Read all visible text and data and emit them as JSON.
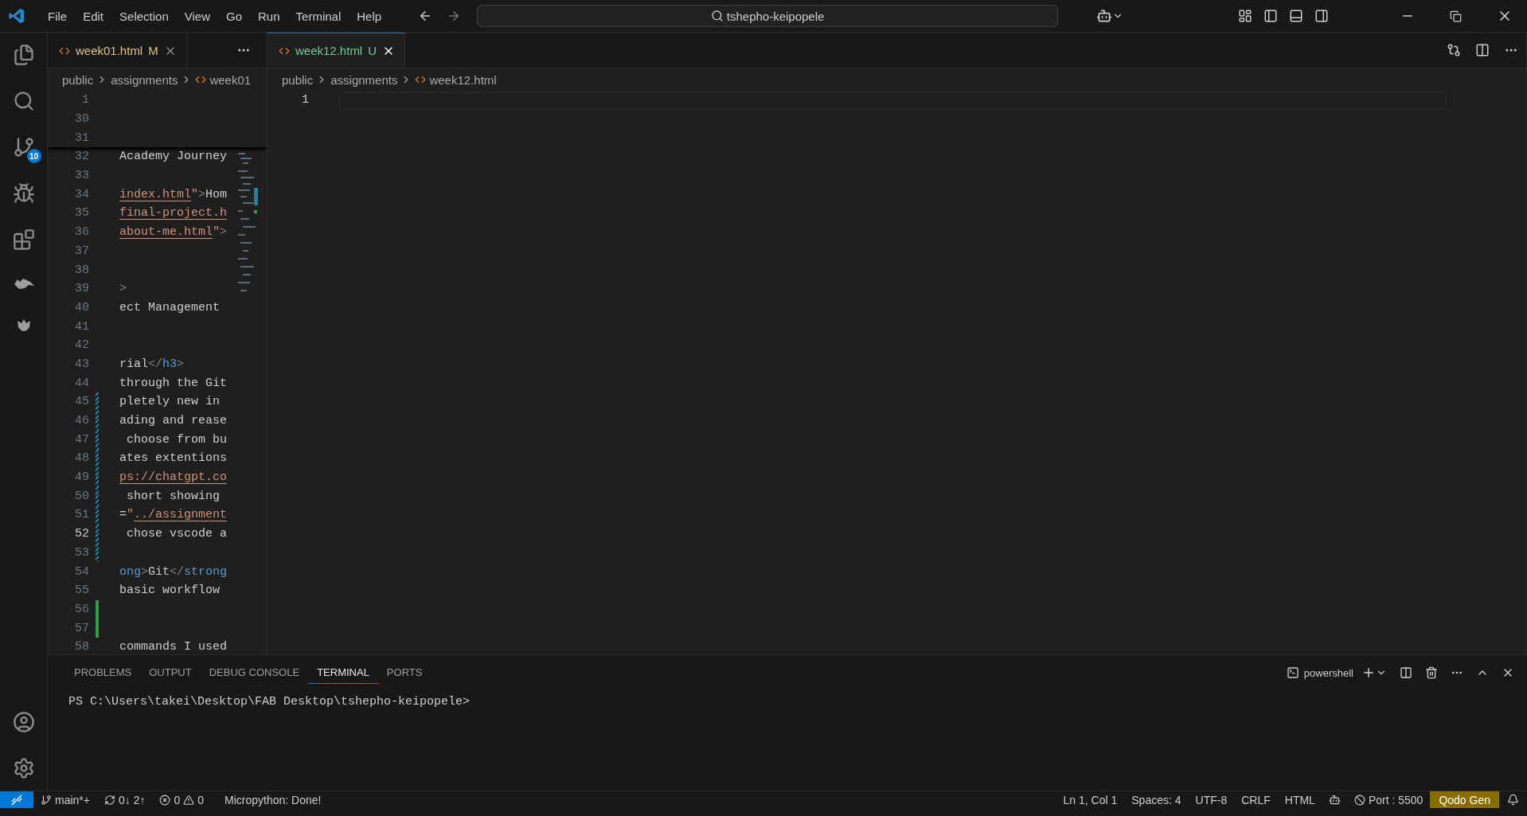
{
  "menu": [
    "File",
    "Edit",
    "Selection",
    "View",
    "Go",
    "Run",
    "Terminal",
    "Help"
  ],
  "command_center": {
    "value": "tshepho-keipopele"
  },
  "activity_bar": {
    "source_control_badge": "10"
  },
  "editor_groups": [
    {
      "tab": {
        "label": "week01.html",
        "status": "M",
        "selected": false
      },
      "breadcrumb": [
        "public",
        "assignments",
        "week01"
      ],
      "sticky_lines": [
        {
          "number": "1"
        },
        {
          "number": "30"
        },
        {
          "number": "31"
        }
      ],
      "lines": [
        {
          "number": "32",
          "current": false,
          "modified": false,
          "added": false,
          "segments": [
            {
              "kind": "text",
              "text": "Academy Journey"
            }
          ]
        },
        {
          "number": "33",
          "current": false,
          "modified": false,
          "added": false
        },
        {
          "number": "34",
          "current": false,
          "modified": false,
          "added": false,
          "segments": [
            {
              "kind": "link",
              "text": "index.html"
            },
            {
              "kind": "string",
              "text": "\""
            },
            {
              "kind": "punct",
              "text": ">"
            },
            {
              "kind": "text",
              "text": "Hom"
            }
          ]
        },
        {
          "number": "35",
          "current": false,
          "modified": false,
          "added": false,
          "segments": [
            {
              "kind": "link",
              "text": "final-project.h"
            }
          ]
        },
        {
          "number": "36",
          "current": false,
          "modified": false,
          "added": false,
          "segments": [
            {
              "kind": "link",
              "text": "about-me.html"
            },
            {
              "kind": "string",
              "text": "\""
            },
            {
              "kind": "punct",
              "text": ">"
            }
          ]
        },
        {
          "number": "37",
          "current": false,
          "modified": false,
          "added": false
        },
        {
          "number": "38",
          "current": false,
          "modified": false,
          "added": false
        },
        {
          "number": "39",
          "current": false,
          "modified": false,
          "added": false,
          "segments": [
            {
              "kind": "punct",
              "text": ">"
            }
          ]
        },
        {
          "number": "40",
          "current": false,
          "modified": false,
          "added": false,
          "segments": [
            {
              "kind": "text",
              "text": "ect Management"
            }
          ]
        },
        {
          "number": "41",
          "current": false,
          "modified": false,
          "added": false
        },
        {
          "number": "42",
          "current": false,
          "modified": false,
          "added": false
        },
        {
          "number": "43",
          "current": false,
          "modified": false,
          "added": false,
          "segments": [
            {
              "kind": "text",
              "text": "rial"
            },
            {
              "kind": "punct",
              "text": "</"
            },
            {
              "kind": "tag",
              "text": "h3"
            },
            {
              "kind": "punct",
              "text": ">"
            }
          ]
        },
        {
          "number": "44",
          "current": false,
          "modified": false,
          "added": false,
          "segments": [
            {
              "kind": "text",
              "text": "through the Git"
            }
          ]
        },
        {
          "number": "45",
          "current": false,
          "modified": true,
          "added": false,
          "segments": [
            {
              "kind": "text",
              "text": "pletely new in"
            }
          ]
        },
        {
          "number": "46",
          "current": false,
          "modified": true,
          "added": false,
          "segments": [
            {
              "kind": "text",
              "text": "ading and rease"
            }
          ]
        },
        {
          "number": "47",
          "current": false,
          "modified": true,
          "added": false,
          "segments": [
            {
              "kind": "text",
              "text": " choose from bu"
            }
          ]
        },
        {
          "number": "48",
          "current": false,
          "modified": true,
          "added": false,
          "segments": [
            {
              "kind": "text",
              "text": "ates extentions"
            }
          ]
        },
        {
          "number": "49",
          "current": false,
          "modified": true,
          "added": false,
          "segments": [
            {
              "kind": "link",
              "text": "ps://chatgpt.co"
            }
          ]
        },
        {
          "number": "50",
          "current": false,
          "modified": true,
          "added": false,
          "segments": [
            {
              "kind": "text",
              "text": " short showing"
            }
          ]
        },
        {
          "number": "51",
          "current": false,
          "modified": true,
          "added": false,
          "segments": [
            {
              "kind": "text",
              "text": "="
            },
            {
              "kind": "string",
              "text": "\""
            },
            {
              "kind": "link",
              "text": "../assignment"
            }
          ]
        },
        {
          "number": "52",
          "current": true,
          "modified": true,
          "added": false,
          "segments": [
            {
              "kind": "text",
              "text": " chose vscode a"
            }
          ]
        },
        {
          "number": "53",
          "current": false,
          "modified": true,
          "added": false
        },
        {
          "number": "54",
          "current": false,
          "modified": false,
          "added": false,
          "segments": [
            {
              "kind": "tag",
              "text": "ong"
            },
            {
              "kind": "punct",
              "text": ">"
            },
            {
              "kind": "text",
              "text": "Git"
            },
            {
              "kind": "punct",
              "text": "</"
            },
            {
              "kind": "tag",
              "text": "strong"
            }
          ]
        },
        {
          "number": "55",
          "current": false,
          "modified": false,
          "added": false,
          "segments": [
            {
              "kind": "text",
              "text": "basic workflow"
            }
          ]
        },
        {
          "number": "56",
          "current": false,
          "modified": false,
          "added": true
        },
        {
          "number": "57",
          "current": false,
          "modified": false,
          "added": true
        },
        {
          "number": "58",
          "current": false,
          "modified": false,
          "added": false,
          "segments": [
            {
              "kind": "text",
              "text": "commands I used"
            }
          ]
        }
      ]
    },
    {
      "tab": {
        "label": "week12.html",
        "status": "U",
        "selected": true
      },
      "breadcrumb": [
        "public",
        "assignments",
        "week12.html"
      ],
      "lines": [
        {
          "number": "1",
          "current": true
        }
      ]
    }
  ],
  "panel": {
    "tabs": [
      {
        "label": "PROBLEMS",
        "selected": false
      },
      {
        "label": "OUTPUT",
        "selected": false
      },
      {
        "label": "DEBUG CONSOLE",
        "selected": false
      },
      {
        "label": "TERMINAL",
        "selected": true
      },
      {
        "label": "PORTS",
        "selected": false
      }
    ],
    "shell": "powershell",
    "prompt": "PS C:\\Users\\takei\\Desktop\\FAB Desktop\\tshepho-keipopele>"
  },
  "status_bar": {
    "branch": "main*+",
    "sync": "0↓ 2↑",
    "errors": "0",
    "warnings": "0",
    "message": "Micropython: Done!",
    "right": [
      "Ln 1, Col 1",
      "Spaces: 4",
      "UTF-8",
      "CRLF",
      "HTML"
    ],
    "port": "Port : 5500",
    "extension": "Qodo Gen"
  }
}
